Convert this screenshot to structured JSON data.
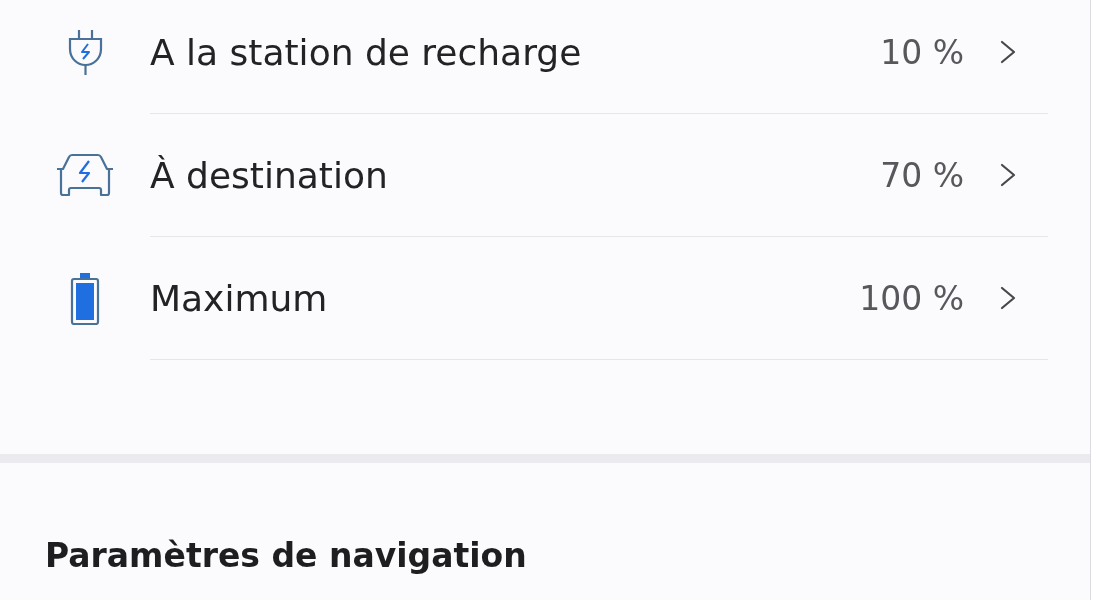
{
  "charge_targets": [
    {
      "kind": "plug",
      "label": "A la station de recharge",
      "value": "10 %"
    },
    {
      "kind": "car",
      "label": "À destination",
      "value": "70 %"
    },
    {
      "kind": "battery",
      "label": "Maximum",
      "value": "100 %"
    }
  ],
  "section": {
    "title": "Paramètres de navigation"
  }
}
